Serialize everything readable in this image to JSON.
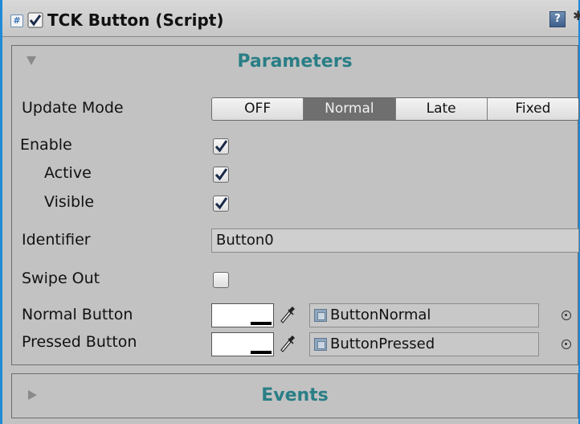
{
  "header": {
    "title": "TCK Button (Script)",
    "enabled": true,
    "script_icon": "script-icon",
    "help_icon": "help-icon",
    "settings_icon": "gear-icon"
  },
  "colors": {
    "window_border": "#1f8ad6",
    "section_title": "#2a7e86",
    "panel_background": "#c2c2c2",
    "selected_segment": "#6f6f6f"
  },
  "parameters": {
    "title": "Parameters",
    "expanded": true,
    "update_mode": {
      "label": "Update Mode",
      "options": [
        "OFF",
        "Normal",
        "Late",
        "Fixed"
      ],
      "selected": "Normal"
    },
    "enable": {
      "label": "Enable",
      "checked": true
    },
    "active": {
      "label": "Active",
      "checked": true
    },
    "visible": {
      "label": "Visible",
      "checked": true
    },
    "identifier": {
      "label": "Identifier",
      "value": "Button0"
    },
    "swipe_out": {
      "label": "Swipe Out",
      "checked": false
    },
    "normal_button": {
      "label": "Normal Button",
      "color": "#ffffff",
      "sprite": "ButtonNormal"
    },
    "pressed_button": {
      "label": "Pressed Button",
      "color": "#ffffff",
      "sprite": "ButtonPressed"
    }
  },
  "events": {
    "title": "Events",
    "expanded": false
  }
}
